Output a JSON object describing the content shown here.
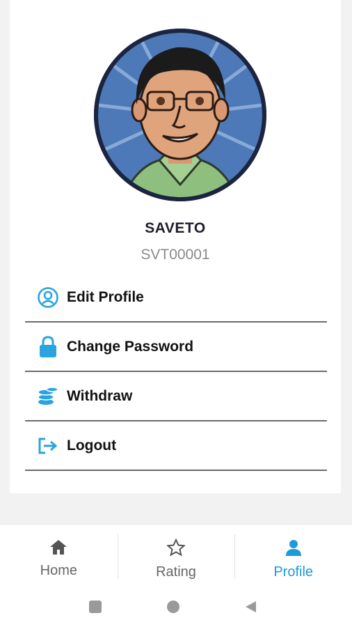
{
  "profile": {
    "name": "SAVETO",
    "code": "SVT00001"
  },
  "menu": [
    {
      "label": "Edit Profile",
      "icon": "user-circle-icon"
    },
    {
      "label": "Change Password",
      "icon": "lock-icon"
    },
    {
      "label": "Withdraw",
      "icon": "coins-icon"
    },
    {
      "label": "Logout",
      "icon": "logout-icon"
    }
  ],
  "tabs": [
    {
      "label": "Home",
      "icon": "home-icon",
      "active": false
    },
    {
      "label": "Rating",
      "icon": "star-icon",
      "active": false
    },
    {
      "label": "Profile",
      "icon": "user-icon",
      "active": true
    }
  ],
  "colors": {
    "accent": "#1e9ad6",
    "menu_icon": "#2aa3de",
    "divider": "#6b6b6b"
  }
}
